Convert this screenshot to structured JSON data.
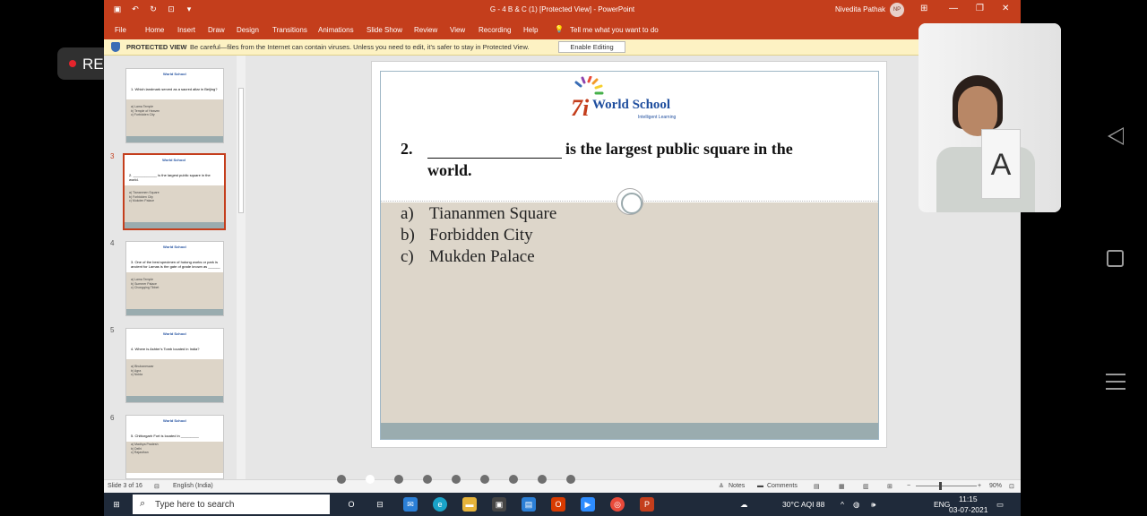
{
  "recording": {
    "label": "REC"
  },
  "app": {
    "title": "G - 4 B & C (1) [Protected View] - PowerPoint",
    "user": "Nivedita Pathak",
    "user_initials": "NP",
    "menu": [
      "File",
      "Home",
      "Insert",
      "Draw",
      "Design",
      "Transitions",
      "Animations",
      "Slide Show",
      "Review",
      "View",
      "Recording",
      "Help"
    ],
    "tell_me": "Tell me what you want to do",
    "protected": {
      "label": "PROTECTED VIEW",
      "message": "Be careful—files from the Internet can contain viruses. Unless you need to edit, it's safer to stay in Protected View.",
      "button": "Enable Editing"
    }
  },
  "thumbnails": [
    {
      "num": "",
      "question": "1.  Which landmark served as a sacred altar in Beijing?",
      "options": [
        "a)  Lama Temple",
        "b)  Temple of Heaven",
        "c)  Forbidden City"
      ]
    },
    {
      "num": "3",
      "question": "2.  ____________ is the largest public square in the world.",
      "options": [
        "a)  Tiananmen Square",
        "b)  Forbidden City",
        "c)  Mukden Palace"
      ]
    },
    {
      "num": "4",
      "question": "3.  One of the best specimen of hutong works or park is ancient for Lamas is the gate of grade known as ______",
      "options": [
        "a)  Lama Temple",
        "b)  Summer Palace",
        "c)  Chongqing Tibbet"
      ]
    },
    {
      "num": "5",
      "question": "4.  Where is Ashter's Tomb located in India?",
      "options": [
        "a)  Bhubaneswar",
        "b)  Agra",
        "c)  Noida"
      ]
    },
    {
      "num": "6",
      "question": "5.  Chittorgarh Fort is located in _________",
      "options": [
        "a)  Madhya Pradesh",
        "b)  Delhi",
        "c)  Rajasthan"
      ]
    }
  ],
  "slide": {
    "logo_brand": "World School",
    "logo_sub": "Intelligent Learning",
    "question_number": "2.",
    "question_text": "is the largest  public square in the",
    "question_text_2": "world.",
    "options": [
      {
        "letter": "a)",
        "text": "Tiananmen Square"
      },
      {
        "letter": "b)",
        "text": "Forbidden City"
      },
      {
        "letter": "c)",
        "text": "Mukden Palace"
      }
    ]
  },
  "status": {
    "slide_info": "Slide 3 of 16",
    "language": "English (India)",
    "notes": "Notes",
    "comments": "Comments",
    "zoom": "90%"
  },
  "taskbar": {
    "search_placeholder": "Type here to search",
    "weather": "30°C  AQI 88",
    "lang": "ENG",
    "time": "11:15",
    "date": "03-07-2021"
  },
  "colors": {
    "accent": "#c43e1c",
    "protected_bg": "#fdf2c3",
    "logo_blue": "#1f4e9e"
  }
}
